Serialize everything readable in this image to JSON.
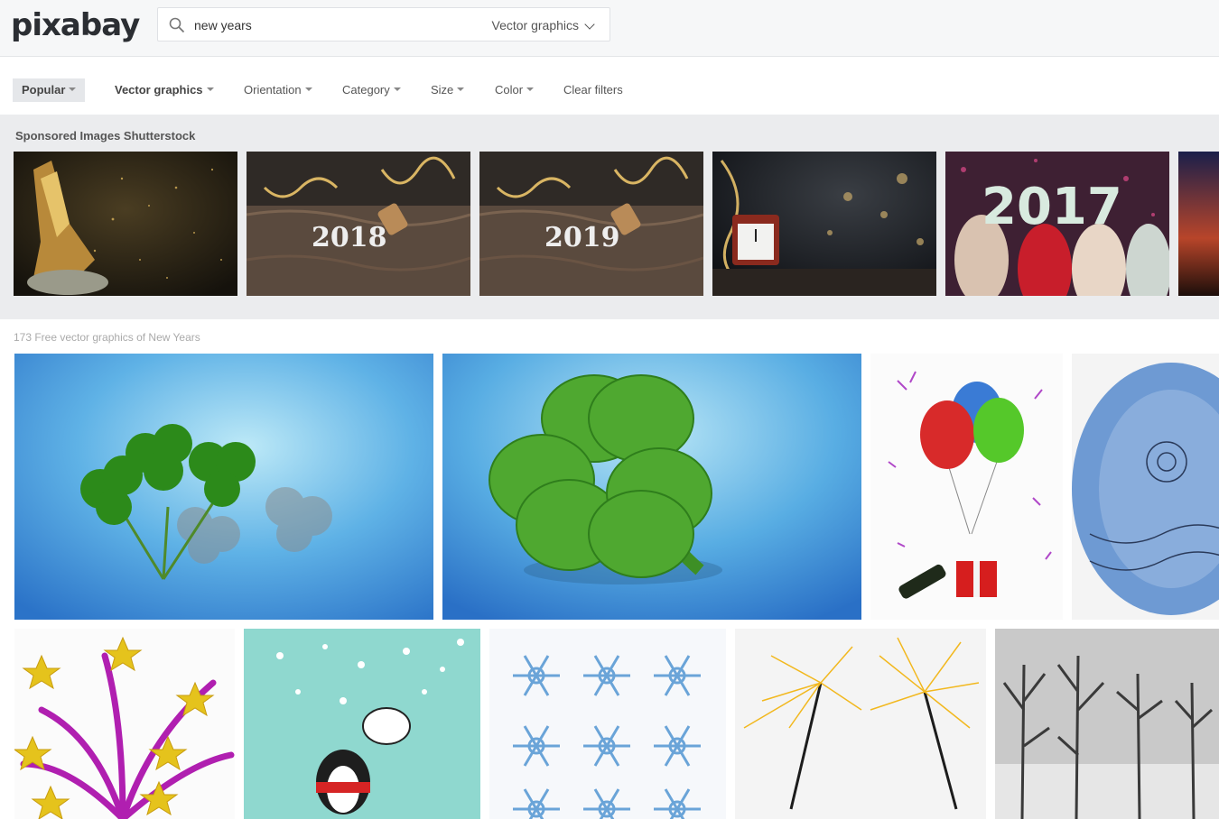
{
  "header": {
    "logo": "pixabay",
    "search_value": "new years",
    "search_type": "Vector graphics",
    "search_icon": "search-icon"
  },
  "filters": {
    "popular": "Popular",
    "vector": "Vector graphics",
    "orientation": "Orientation",
    "category": "Category",
    "size": "Size",
    "color": "Color",
    "clear": "Clear filters"
  },
  "sponsored": {
    "title": "Sponsored Images Shutterstock",
    "images": [
      {
        "label": "champagne"
      },
      {
        "label": "2018"
      },
      {
        "label": "2019"
      },
      {
        "label": "clock"
      },
      {
        "label": "2017"
      },
      {
        "label": "sunset"
      }
    ]
  },
  "results": {
    "count_text": "173 Free vector graphics of New Years"
  },
  "colors": {
    "header_bg": "#f6f7f8",
    "sponsored_bg": "#ebecee",
    "clover_green": "#3aa12c",
    "sky_blue": "#3f8fd8"
  }
}
